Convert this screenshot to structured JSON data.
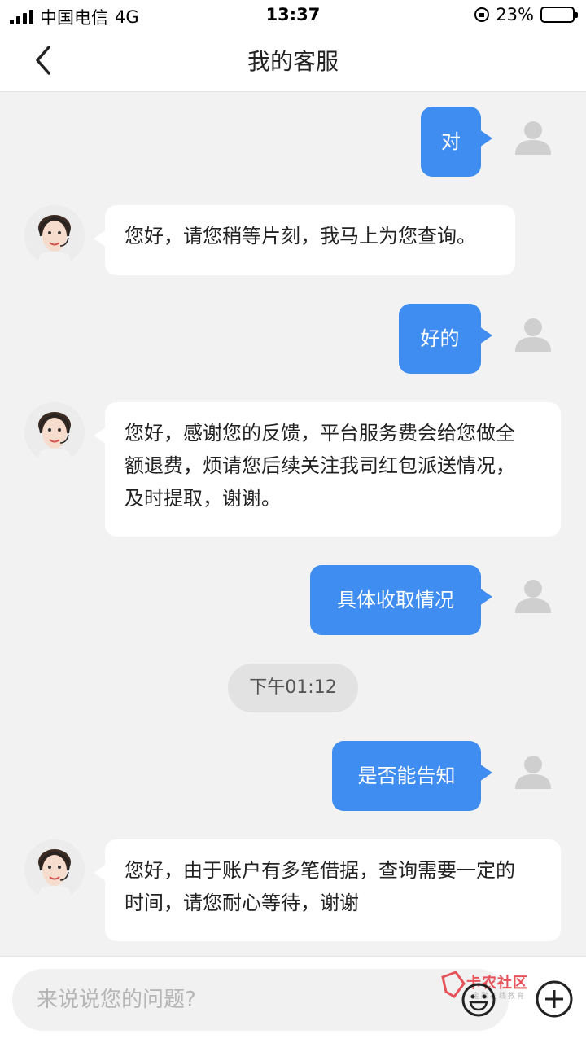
{
  "status_bar": {
    "carrier": "中国电信",
    "network": "4G",
    "time": "13:37",
    "battery": "23%",
    "battery_level": 0.23
  },
  "header": {
    "title": "我的客服",
    "back_icon": "chevron-left-icon"
  },
  "messages": [
    {
      "side": "right",
      "text": "对"
    },
    {
      "side": "left",
      "text": "您好，请您稍等片刻，我马上为您查询。"
    },
    {
      "side": "right",
      "text": "好的"
    },
    {
      "side": "left",
      "lines": [
        "您好，感谢您的反馈，平台服务费会给您做全",
        "额退费，烦请您后续关注我司红包派送情况，",
        "及时提取，谢谢。"
      ]
    },
    {
      "side": "right",
      "text": "具体收取情况"
    },
    {
      "side": "right",
      "text": "是否能告知"
    },
    {
      "side": "left",
      "lines": [
        "您好，由于账户有多笔借据，查询需要一定的",
        "时间，请您耐心等待，谢谢"
      ]
    }
  ],
  "timestamp": "下午01:12",
  "input": {
    "placeholder": "来说说您的问题?"
  },
  "watermark": {
    "text": "卡农社区",
    "sub": "金融在线教育"
  },
  "colors": {
    "accent": "#3f8df0",
    "background": "#f2f2f2",
    "watermark": "#e6525a"
  }
}
